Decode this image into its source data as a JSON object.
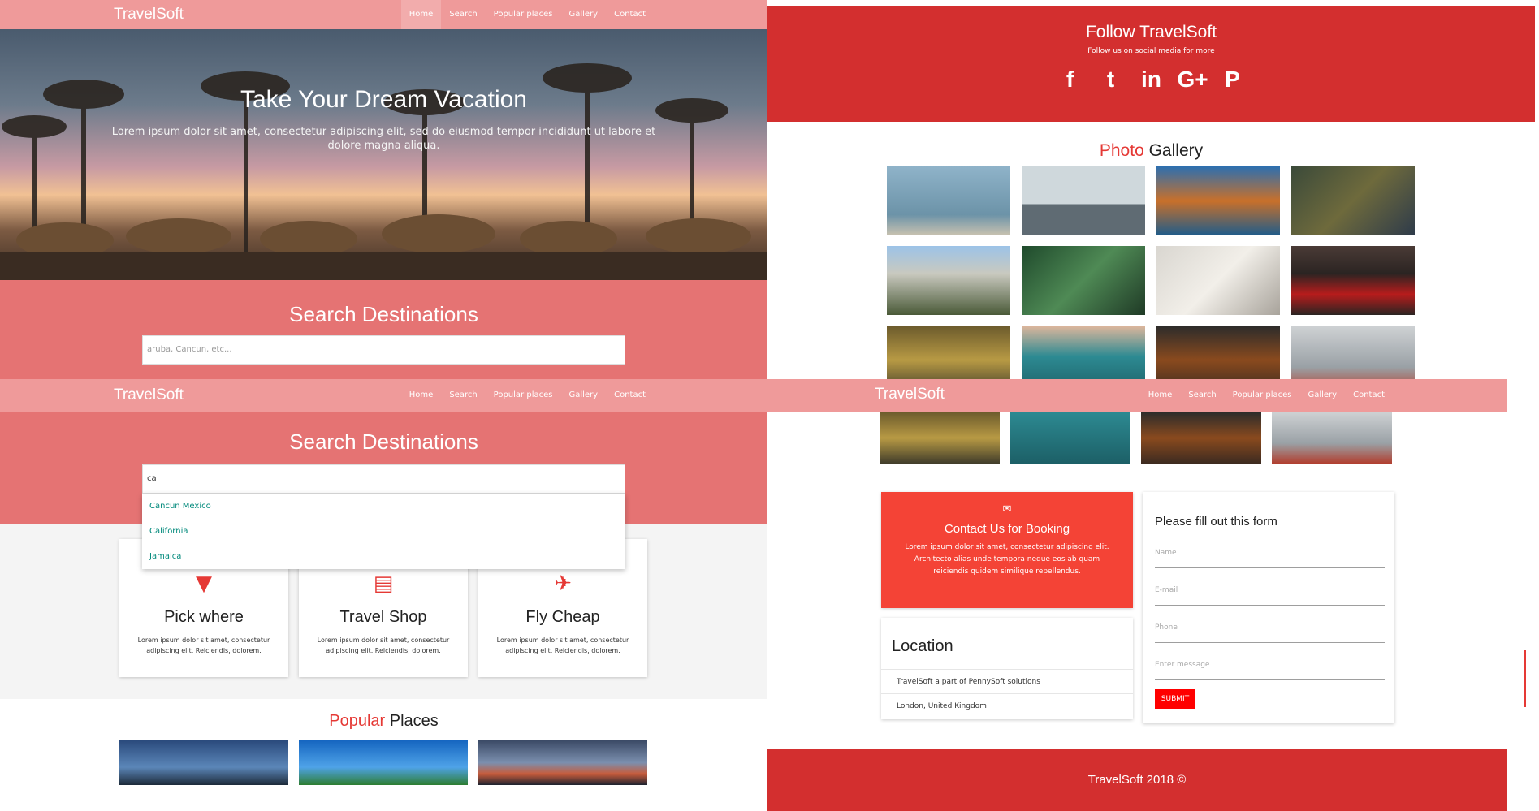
{
  "brand": "TravelSoft",
  "nav": [
    "Home",
    "Search",
    "Popular places",
    "Gallery",
    "Contact"
  ],
  "hero": {
    "title": "Take Your Dream Vacation",
    "text": "Lorem ipsum dolor sit amet, consectetur adipiscing elit, sed do eiusmod tempor incididunt ut labore et dolore magna aliqua."
  },
  "search": {
    "title": "Search Destinations",
    "placeholder": "aruba, Cancun, etc...",
    "typed_value": "ca",
    "suggestions": [
      "Cancun Mexico",
      "California",
      "Jamaica"
    ]
  },
  "features": [
    {
      "title": "Pick where",
      "text": "Lorem ipsum dolor sit amet, consectetur adipiscing elit. Reiciendis, dolorem."
    },
    {
      "title": "Travel Shop",
      "text": "Lorem ipsum dolor sit amet, consectetur adipiscing elit. Reiciendis, dolorem."
    },
    {
      "title": "Fly Cheap",
      "text": "Lorem ipsum dolor sit amet, consectetur adipiscing elit. Reiciendis, dolorem."
    }
  ],
  "popular": {
    "title_accent": "Popular",
    "title_rest": " Places"
  },
  "follow": {
    "title": "Follow TravelSoft",
    "subtitle": "Follow us on social media for more",
    "icons": [
      "f",
      "t",
      "in",
      "G+",
      "P"
    ]
  },
  "gallery": {
    "title_accent": "Photo",
    "title_rest": " Gallery"
  },
  "contact": {
    "title": "Contact Us for Booking",
    "text": "Lorem ipsum dolor sit amet, consectetur adipiscing elit. Architecto alias unde tempora neque eos ab quam reiciendis quidem similique repellendus.",
    "mail_icon": "✉"
  },
  "location": {
    "title": "Location",
    "lines": [
      "TravelSoft a part of PennySoft solutions",
      "London, United Kingdom"
    ]
  },
  "form": {
    "title": "Please fill out this form",
    "fields": [
      "Name",
      "E-mail",
      "Phone",
      "Enter message"
    ],
    "submit": "SUBMIT"
  },
  "footer": "TravelSoft 2018 ©",
  "colors": {
    "nav": "#ef9a9a",
    "search_band": "#e57373",
    "red": "#d32f2f",
    "accent": "#f44336",
    "submit": "#ff0000"
  }
}
